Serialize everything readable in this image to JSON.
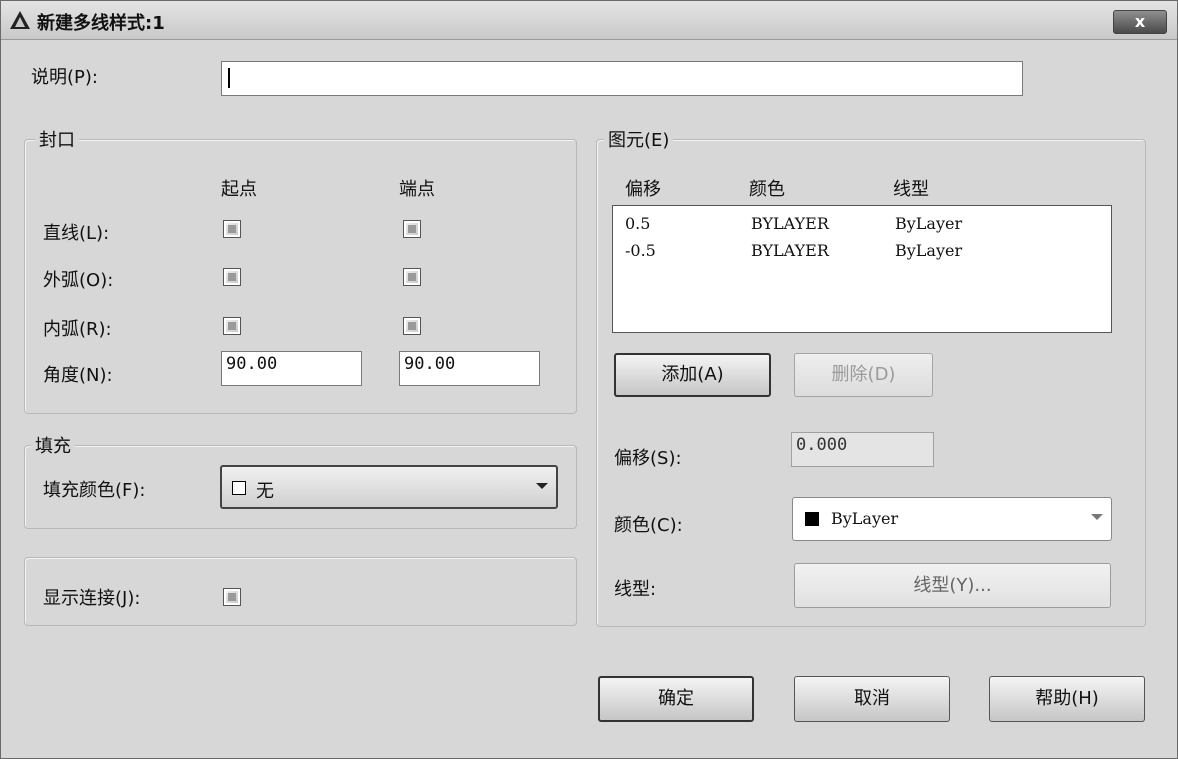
{
  "window": {
    "title": "新建多线样式:1",
    "close_label": "x"
  },
  "description": {
    "label": "说明(P):",
    "value": ""
  },
  "caps": {
    "group_label": "封口",
    "col_start": "起点",
    "col_end": "端点",
    "line_label": "直线(L):",
    "outer_arc_label": "外弧(O):",
    "inner_arc_label": "内弧(R):",
    "angle_label": "角度(N):",
    "line_start_checked": false,
    "line_end_checked": false,
    "outer_start_checked": false,
    "outer_end_checked": false,
    "inner_start_checked": false,
    "inner_end_checked": false,
    "angle_start": "90.00",
    "angle_end": "90.00"
  },
  "fill": {
    "group_label": "填充",
    "color_label": "填充颜色(F):",
    "color_value": "无",
    "swatch_color": "#ffffff"
  },
  "show_joints": {
    "label": "显示连接(J):",
    "checked": false
  },
  "elements": {
    "group_label": "图元(E)",
    "columns": [
      "偏移",
      "颜色",
      "线型"
    ],
    "rows": [
      {
        "offset": "0.5",
        "color": "BYLAYER",
        "linetype": "ByLayer"
      },
      {
        "offset": "-0.5",
        "color": "BYLAYER",
        "linetype": "ByLayer"
      }
    ],
    "add_label": "添加(A)",
    "delete_label": "删除(D)",
    "offset_label": "偏移(S):",
    "offset_value": "0.000",
    "color_label": "颜色(C):",
    "color_value": "ByLayer",
    "color_swatch": "#000000",
    "linetype_label": "线型:",
    "linetype_button": "线型(Y)..."
  },
  "buttons": {
    "ok": "确定",
    "cancel": "取消",
    "help": "帮助(H)"
  }
}
